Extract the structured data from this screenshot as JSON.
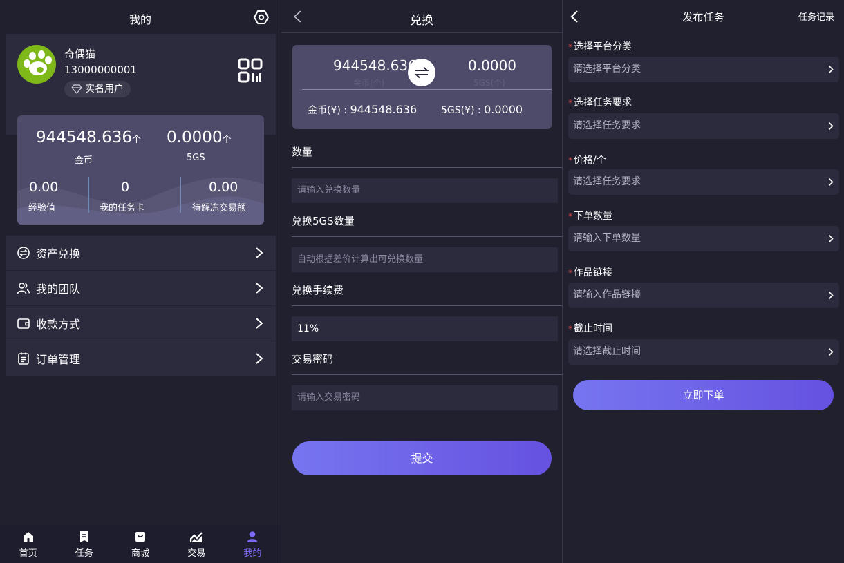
{
  "colors": {
    "background": "#20202f",
    "card": "#2c2b3d",
    "stats_card": "#4d4a6a",
    "accent": "#7a6bf2",
    "required": "#e6453f",
    "avatar": "#7fb819"
  },
  "mine": {
    "title": "我的",
    "settings_icon": "gear-icon",
    "profile": {
      "name": "奇偶猫",
      "phone": "13000000001",
      "badge_icon": "diamond-icon",
      "badge": "实名用户",
      "qr_icon": "qr-code-icon"
    },
    "stats": {
      "gold_value": "944548.636",
      "gold_unit": "个",
      "gold_label": "金币",
      "sgs_value": "0.0000",
      "sgs_unit": "个",
      "sgs_label": "5GS",
      "exp_value": "0.00",
      "exp_label": "经验值",
      "taskcard_value": "0",
      "taskcard_label": "我的任务卡",
      "frozen_value": "0.00",
      "frozen_label": "待解冻交易额"
    },
    "menu": [
      {
        "icon": "exchange-icon",
        "label": "资产兑换"
      },
      {
        "icon": "team-icon",
        "label": "我的团队"
      },
      {
        "icon": "wallet-icon",
        "label": "收款方式"
      },
      {
        "icon": "order-list-icon",
        "label": "订单管理"
      }
    ],
    "tabs": [
      {
        "icon": "home-icon",
        "label": "首页"
      },
      {
        "icon": "task-icon",
        "label": "任务"
      },
      {
        "icon": "shop-icon",
        "label": "商城"
      },
      {
        "icon": "trade-chart-icon",
        "label": "交易"
      },
      {
        "icon": "user-icon",
        "label": "我的"
      }
    ],
    "active_tab": "我的"
  },
  "exchange": {
    "title": "兑换",
    "from_value": "944548.636",
    "from_unit": "金币(个)",
    "to_value": "0.0000",
    "to_unit": "5GS(个)",
    "from_balance_label": "金币(¥) : ",
    "from_balance_value": "944548.636",
    "to_balance_label": "5GS(¥) : ",
    "to_balance_value": "0.0000",
    "quantity_label": "数量",
    "quantity_placeholder": "请输入兑换数量",
    "sgs_qty_label": "兑换5GS数量",
    "sgs_qty_placeholder": "自动根据差价计算出可兑换数量",
    "fee_label": "兑换手续费",
    "fee_value": "11%",
    "password_label": "交易密码",
    "password_placeholder": "请输入交易密码",
    "submit": "提交"
  },
  "publish": {
    "title": "发布任务",
    "record_link": "任务记录",
    "required_mark": "*",
    "fields": [
      {
        "label": "选择平台分类",
        "placeholder": "请选择平台分类"
      },
      {
        "label": "选择任务要求",
        "placeholder": "请选择任务要求"
      },
      {
        "label": "价格/个",
        "placeholder": "请选择任务要求"
      },
      {
        "label": "下单数量",
        "placeholder": "请输入下单数量"
      },
      {
        "label": "作品链接",
        "placeholder": "请输入作品链接"
      },
      {
        "label": "截止时间",
        "placeholder": "请选择截止时间"
      }
    ],
    "submit": "立即下单"
  }
}
